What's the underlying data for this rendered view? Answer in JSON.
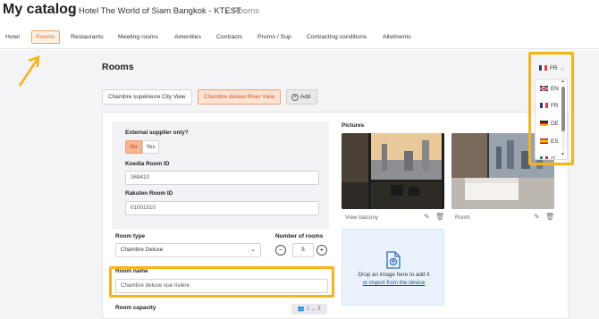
{
  "header": {
    "title": "My catalog",
    "breadcrumb_hotel": "Hotel The World of Siam Bangkok - KTEST",
    "breadcrumb_current": "Rooms",
    "separator": "›"
  },
  "nav": {
    "items": [
      "Hotel",
      "Rooms",
      "Restaurants",
      "Meeting rooms",
      "Amenities",
      "Contracts",
      "Promo / Sup",
      "Contracting conditions",
      "Allotments"
    ],
    "active": "Rooms"
  },
  "page": {
    "title": "Rooms"
  },
  "room_tabs": {
    "items": [
      "Chambre supérieure City View",
      "Chambre deluxe River View"
    ],
    "active": "Chambre deluxe River View",
    "add_label": "Add"
  },
  "form": {
    "external_supplier_label": "External supplier only?",
    "toggle_no": "No",
    "toggle_yes": "Yes",
    "koedia_label": "Koedia Room ID",
    "koedia_value": "369410",
    "rakuten_label": "Rakuten Room ID",
    "rakuten_value": "01001510",
    "room_type_label": "Room type",
    "room_type_value": "Chambre Deluxe",
    "number_rooms_label": "Number of rooms",
    "number_rooms_value": "5",
    "room_name_label": "Room name",
    "room_name_value": "Chambre deluxe vue rivière",
    "room_capacity_label": "Room capacity",
    "capacity_badge": "1 ↔ 3"
  },
  "pictures": {
    "label": "Pictures",
    "items": [
      {
        "caption": "View balcony"
      },
      {
        "caption": "Room"
      }
    ],
    "drop_text": "Drop an image here to add it",
    "drop_link": "or import from the device"
  },
  "language": {
    "selected": "FR",
    "options": [
      "EN",
      "FR",
      "DE",
      "ES",
      "IT"
    ]
  },
  "colors": {
    "accent": "#e06a1f",
    "highlight": "#f7b318",
    "link": "#1e4f8c"
  }
}
